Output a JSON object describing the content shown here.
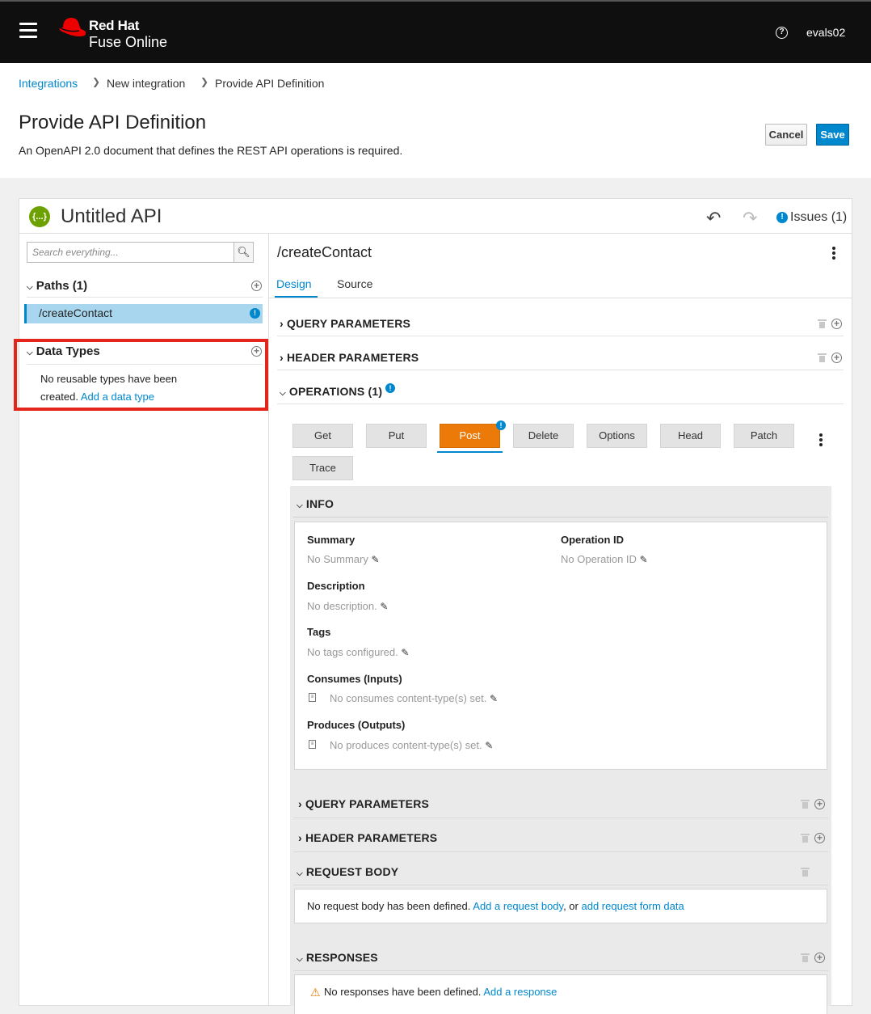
{
  "topbar": {
    "brand_line1": "Red Hat",
    "brand_line2": "Fuse Online",
    "help_icon": "?",
    "username": "evals02"
  },
  "breadcrumb": {
    "items": [
      "Integrations",
      "New integration",
      "Provide API Definition"
    ]
  },
  "header": {
    "title": "Provide API Definition",
    "subtitle": "An OpenAPI 2.0 document that defines the REST API operations is required.",
    "cancel_label": "Cancel",
    "save_label": "Save"
  },
  "editor": {
    "api_icon": "{...}",
    "api_title": "Untitled API",
    "issues_label": "Issues (1)",
    "search_placeholder": "Search everything...",
    "paths_header": "Paths (1)",
    "path_item": "/createContact",
    "data_types_header": "Data Types",
    "data_types_empty": "No reusable types have been",
    "data_types_empty2": "created.",
    "add_data_type": "Add a data type"
  },
  "detail": {
    "path_title": "/createContact",
    "tabs": [
      "Design",
      "Source"
    ],
    "query_params": "QUERY PARAMETERS",
    "header_params": "HEADER PARAMETERS",
    "operations": "OPERATIONS (1)",
    "verbs": [
      "Get",
      "Put",
      "Post",
      "Delete",
      "Options",
      "Head",
      "Patch",
      "Trace"
    ],
    "active_verb": "Post"
  },
  "operation": {
    "info_header": "INFO",
    "summary_label": "Summary",
    "summary_value": "No Summary",
    "operation_id_label": "Operation ID",
    "operation_id_value": "No Operation ID",
    "description_label": "Description",
    "description_value": "No description.",
    "tags_label": "Tags",
    "tags_value": "No tags configured.",
    "consumes_label": "Consumes (Inputs)",
    "consumes_value": "No consumes content-type(s) set.",
    "produces_label": "Produces (Outputs)",
    "produces_value": "No produces content-type(s) set.",
    "query_params": "QUERY PARAMETERS",
    "header_params": "HEADER PARAMETERS",
    "request_body": "REQUEST BODY",
    "rb_text": "No request body has been defined.",
    "rb_link1": "Add a request body",
    "rb_or": ", or",
    "rb_link2": "add request form data",
    "responses": "RESPONSES",
    "responses_text": "No responses have been defined.",
    "add_response": "Add a response"
  },
  "colors": {
    "accent": "#0088ce",
    "active_verb": "#ec7a08",
    "highlight": "#e4251b"
  }
}
